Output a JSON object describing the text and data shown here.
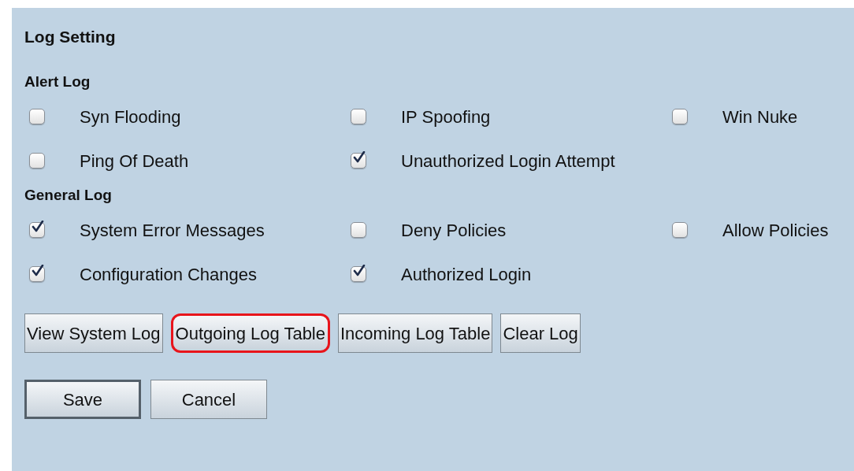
{
  "title": "Log Setting",
  "sections": [
    {
      "heading": "Alert Log",
      "rows": [
        [
          {
            "label": "Syn Flooding",
            "checked": false
          },
          {
            "label": "IP Spoofing",
            "checked": false
          },
          {
            "label": "Win Nuke",
            "checked": false
          }
        ],
        [
          {
            "label": "Ping Of Death",
            "checked": false
          },
          {
            "label": "Unauthorized Login Attempt",
            "checked": true
          }
        ]
      ]
    },
    {
      "heading": "General Log",
      "rows": [
        [
          {
            "label": "System Error Messages",
            "checked": true
          },
          {
            "label": "Deny Policies",
            "checked": false
          },
          {
            "label": "Allow Policies",
            "checked": false
          }
        ],
        [
          {
            "label": "Configuration Changes",
            "checked": true
          },
          {
            "label": "Authorized Login",
            "checked": true
          }
        ]
      ]
    }
  ],
  "log_buttons": [
    {
      "label": "View System Log",
      "highlighted": false
    },
    {
      "label": "Outgoing Log Table",
      "highlighted": true
    },
    {
      "label": "Incoming Log Table",
      "highlighted": false
    },
    {
      "label": "Clear Log",
      "highlighted": false
    }
  ],
  "actions": [
    {
      "label": "Save",
      "selected": true
    },
    {
      "label": "Cancel",
      "selected": false
    }
  ]
}
